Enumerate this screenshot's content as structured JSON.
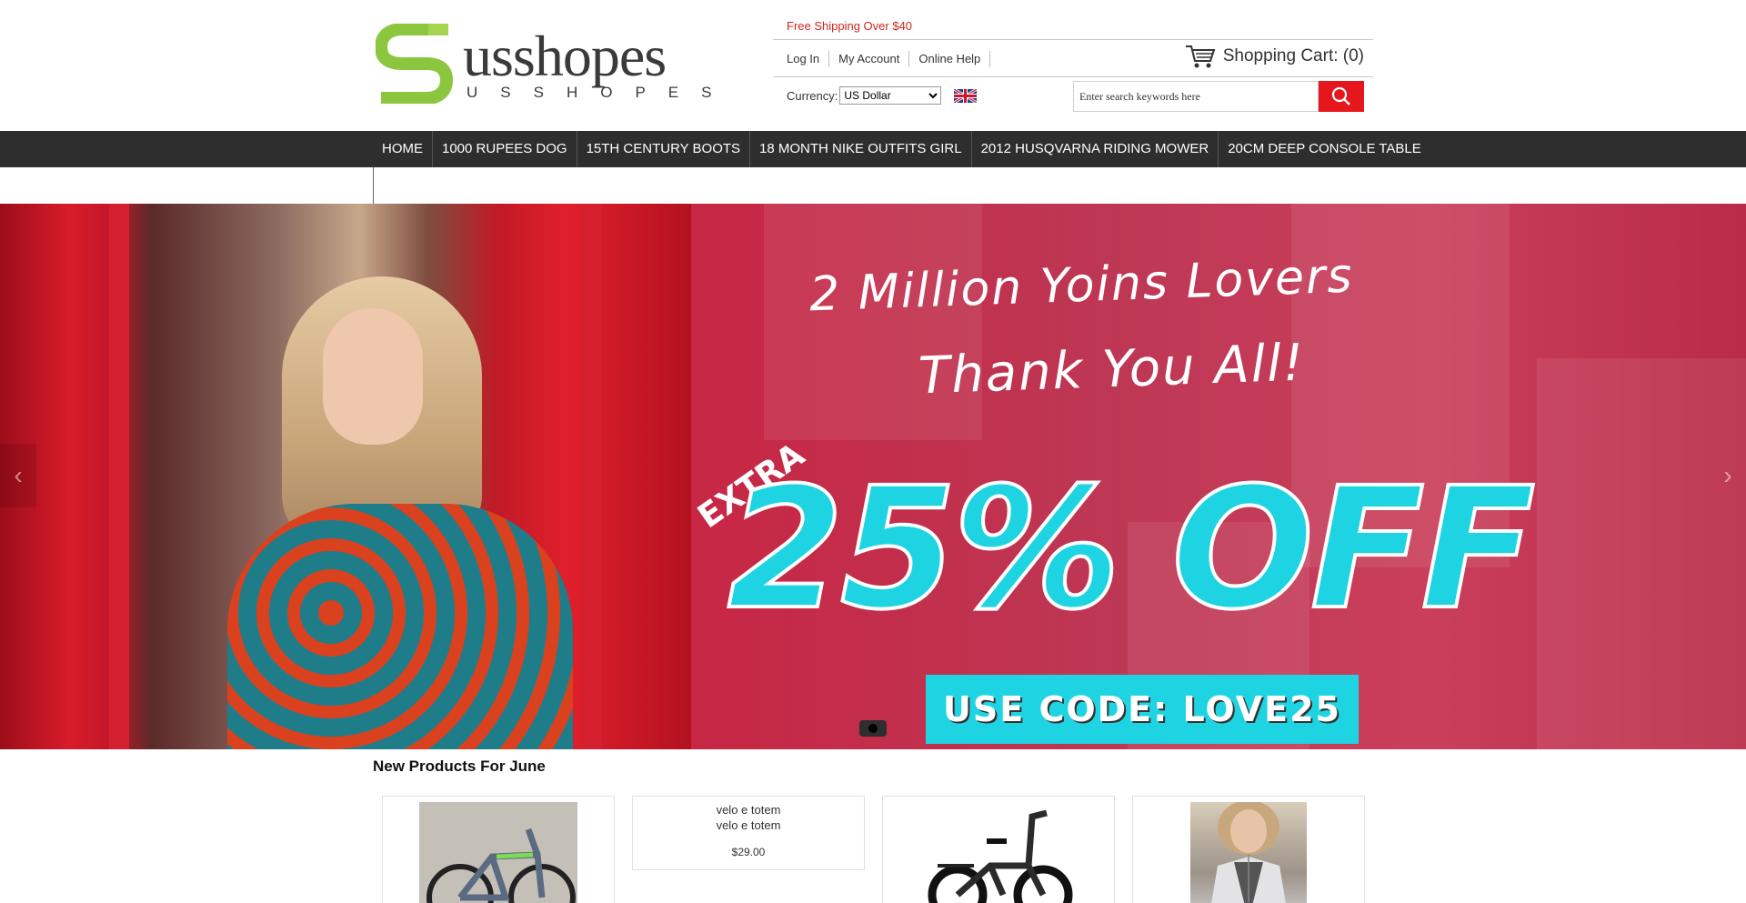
{
  "header": {
    "logo": {
      "word": "usshopes",
      "sub": "USSHOPES"
    },
    "shipping_note": "Free Shipping Over $40",
    "links": [
      "Log In",
      "My Account",
      "Online Help"
    ],
    "cart_label": "Shopping Cart: (0)",
    "currency_label": "Currency:",
    "currency_selected": "US Dollar",
    "search_placeholder": "Enter search keywords here"
  },
  "nav": {
    "items": [
      "HOME",
      "1000 RUPEES DOG",
      "15TH CENTURY BOOTS",
      "18 MONTH NIKE OUTFITS GIRL",
      "2012 HUSQVARNA RIDING MOWER",
      "20CM DEEP CONSOLE TABLE"
    ]
  },
  "banner": {
    "headline1": "2 Million Yoins Lovers",
    "headline2": "Thank You All!",
    "extra": "EXTRA",
    "discount": "25% OFF",
    "code": "USE CODE: LOVE25",
    "slide_count": 1,
    "active_slide": 1
  },
  "products": {
    "title": "New Products For June",
    "items": [
      {
        "alt": "",
        "price": ""
      },
      {
        "alt": "velo e totem",
        "price": "$29.00"
      },
      {
        "alt": "",
        "price": ""
      },
      {
        "alt": "",
        "price": ""
      }
    ]
  },
  "colors": {
    "accent_red": "#e5161c",
    "nav_bg": "#2e2e2e",
    "cyan": "#1fd4e2",
    "logo_green": "#8cc63f"
  },
  "icons": [
    "cart-icon",
    "uk-flag-icon",
    "search-icon",
    "arrow-left-icon",
    "arrow-right-icon"
  ]
}
